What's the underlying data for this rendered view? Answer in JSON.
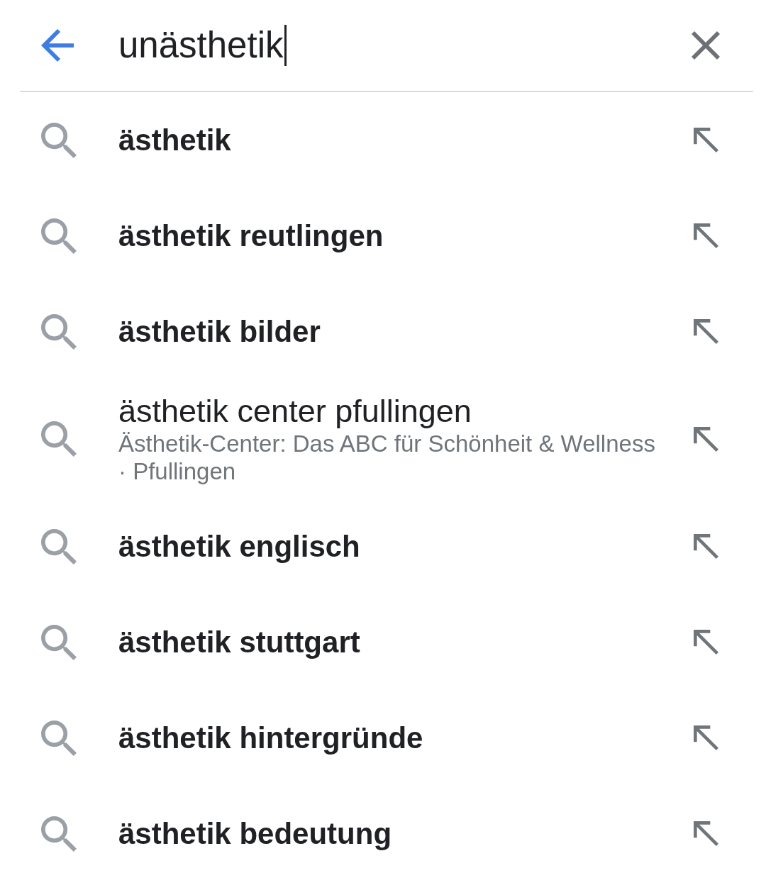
{
  "search_bar": {
    "value": "unästhetik",
    "cursor": true
  },
  "suggestions": [
    {
      "kind": "query",
      "text": "ästhetik"
    },
    {
      "kind": "query",
      "text": "ästhetik reutlingen"
    },
    {
      "kind": "query",
      "text": "ästhetik bilder"
    },
    {
      "kind": "entity",
      "text": "ästhetik center pfullingen",
      "subtitle": "Ästhetik-Center: Das ABC für Schönheit & Wellness · Pfullingen"
    },
    {
      "kind": "query",
      "text": "ästhetik englisch"
    },
    {
      "kind": "query",
      "text": "ästhetik stuttgart"
    },
    {
      "kind": "query",
      "text": "ästhetik hintergründe"
    },
    {
      "kind": "query",
      "text": "ästhetik bedeutung"
    }
  ]
}
